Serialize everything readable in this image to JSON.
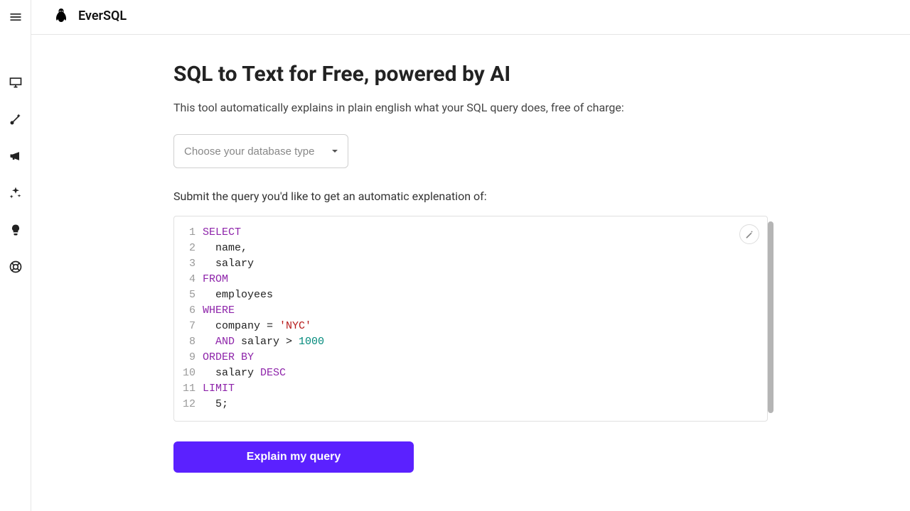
{
  "brand": "EverSQL",
  "sidebar": {
    "hamburger": "hamburger-icon",
    "items": [
      "monitor-icon",
      "wand-icon",
      "megaphone-icon",
      "sparkles-icon",
      "bulb-icon",
      "lifebuoy-icon"
    ]
  },
  "page": {
    "title": "SQL to Text for Free, powered by AI",
    "subtitle": "This tool automatically explains in plain english what your SQL query does, free of charge:",
    "db_placeholder": "Choose your database type",
    "submit_label": "Submit the query you'd like to get an automatic explenation of:",
    "button_label": "Explain my query"
  },
  "editor": {
    "lines": [
      {
        "n": 1,
        "tokens": [
          [
            "kw",
            "SELECT"
          ]
        ]
      },
      {
        "n": 2,
        "tokens": [
          [
            "txt",
            "  name,"
          ]
        ]
      },
      {
        "n": 3,
        "tokens": [
          [
            "txt",
            "  salary"
          ]
        ]
      },
      {
        "n": 4,
        "tokens": [
          [
            "kw",
            "FROM"
          ]
        ]
      },
      {
        "n": 5,
        "tokens": [
          [
            "txt",
            "  employees"
          ]
        ]
      },
      {
        "n": 6,
        "tokens": [
          [
            "kw",
            "WHERE"
          ]
        ]
      },
      {
        "n": 7,
        "tokens": [
          [
            "txt",
            "  company = "
          ],
          [
            "str",
            "'NYC'"
          ]
        ]
      },
      {
        "n": 8,
        "tokens": [
          [
            "txt",
            "  "
          ],
          [
            "kw",
            "AND"
          ],
          [
            "txt",
            " salary > "
          ],
          [
            "num",
            "1000"
          ]
        ]
      },
      {
        "n": 9,
        "tokens": [
          [
            "kw",
            "ORDER BY"
          ]
        ]
      },
      {
        "n": 10,
        "tokens": [
          [
            "txt",
            "  salary "
          ],
          [
            "kw",
            "DESC"
          ]
        ]
      },
      {
        "n": 11,
        "tokens": [
          [
            "kw",
            "LIMIT"
          ]
        ]
      },
      {
        "n": 12,
        "tokens": [
          [
            "txt",
            "  5;"
          ]
        ]
      }
    ]
  }
}
